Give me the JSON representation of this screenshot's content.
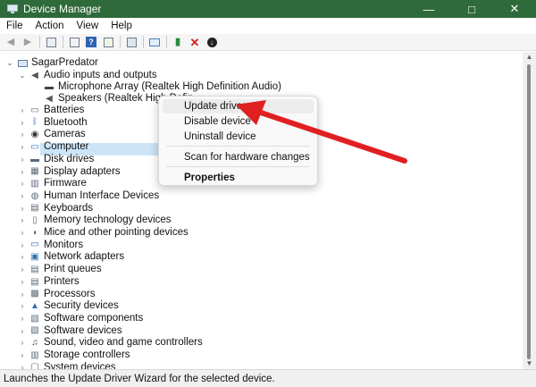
{
  "window": {
    "title": "Device Manager",
    "controls": [
      "—",
      "□",
      "✕"
    ]
  },
  "menu": [
    "File",
    "Action",
    "View",
    "Help"
  ],
  "tree": {
    "root": "SagarPredator",
    "audio": {
      "label": "Audio inputs and outputs",
      "children": [
        "Microphone Array (Realtek High Definition Audio)",
        "Speakers (Realtek High Defin"
      ]
    },
    "categories": [
      {
        "label": "Batteries",
        "icon": "battery-icon"
      },
      {
        "label": "Bluetooth",
        "icon": "bluetooth-icon"
      },
      {
        "label": "Cameras",
        "icon": "camera-icon"
      },
      {
        "label": "Computer",
        "icon": "computer-icon"
      },
      {
        "label": "Disk drives",
        "icon": "disk-icon"
      },
      {
        "label": "Display adapters",
        "icon": "display-adapter-icon"
      },
      {
        "label": "Firmware",
        "icon": "firmware-icon"
      },
      {
        "label": "Human Interface Devices",
        "icon": "hid-icon"
      },
      {
        "label": "Keyboards",
        "icon": "keyboard-icon"
      },
      {
        "label": "Memory technology devices",
        "icon": "memory-icon"
      },
      {
        "label": "Mice and other pointing devices",
        "icon": "mouse-icon"
      },
      {
        "label": "Monitors",
        "icon": "monitor-icon"
      },
      {
        "label": "Network adapters",
        "icon": "network-icon"
      },
      {
        "label": "Print queues",
        "icon": "printer-icon"
      },
      {
        "label": "Printers",
        "icon": "printer-icon"
      },
      {
        "label": "Processors",
        "icon": "processor-icon"
      },
      {
        "label": "Security devices",
        "icon": "security-icon"
      },
      {
        "label": "Software components",
        "icon": "software-icon"
      },
      {
        "label": "Software devices",
        "icon": "software-icon"
      },
      {
        "label": "Sound, video and game controllers",
        "icon": "sound-icon"
      },
      {
        "label": "Storage controllers",
        "icon": "storage-icon"
      },
      {
        "label": "System devices",
        "icon": "system-icon"
      }
    ]
  },
  "context_menu": {
    "update": "Update driver",
    "disable": "Disable device",
    "uninstall": "Uninstall device",
    "scan": "Scan for hardware changes",
    "properties": "Properties"
  },
  "status": "Launches the Update Driver Wizard for the selected device.",
  "colors": {
    "titlebar": "#2f6b3a",
    "selection": "#cce4f7",
    "arrow": "#e02020"
  }
}
